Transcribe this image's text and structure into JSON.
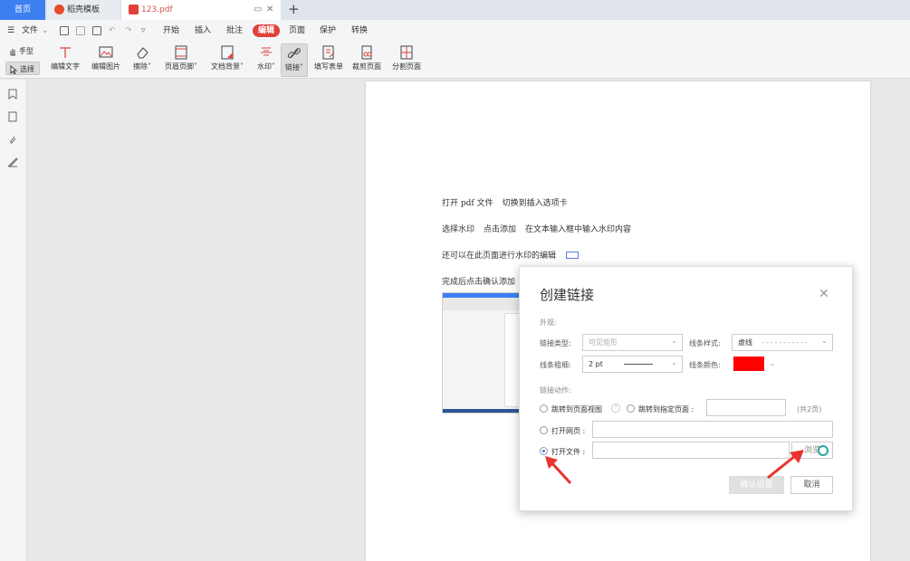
{
  "tabs": {
    "home": "首页",
    "templates": "稻壳模板",
    "document": "123.pdf"
  },
  "menu": {
    "file": "文件",
    "items": [
      "开始",
      "插入",
      "批注",
      "编辑",
      "页面",
      "保护",
      "转换"
    ],
    "active": "编辑"
  },
  "ribbon": {
    "hand": "手型",
    "select": "选择",
    "edit_text": "编辑文字",
    "edit_image": "编辑图片",
    "erase": "擦除",
    "header_footer": "页眉页脚",
    "doc_background": "文档背景",
    "watermark": "水印",
    "link": "链接",
    "fill_form": "填写表单",
    "crop_page": "裁剪页面",
    "split_page": "分割页面"
  },
  "document": {
    "line1": [
      "打开 pdf 文件",
      "切换到插入选项卡"
    ],
    "line2": [
      "选择水印",
      "点击添加",
      "在文本输入框中输入水印内容"
    ],
    "line3": "还可以在此页面进行水印的编辑",
    "line4": "完成后点击确认添加"
  },
  "dialog": {
    "title": "创建链接",
    "appearance_section": "外观:",
    "link_type_label": "链接类型:",
    "link_type_value": "可见矩形",
    "line_style_label": "线条样式:",
    "line_style_value": "虚线",
    "line_style_preview": "- - - - - - - - - - -",
    "line_width_label": "线条粗细:",
    "line_width_value": "2 pt",
    "line_color_label": "线条颜色:",
    "line_color": "#ff0000",
    "action_section": "链接动作:",
    "action_page_view": "跳转到页面视图",
    "action_specific_page": "跳转到指定页面 :",
    "total_pages": "(共2页)",
    "action_web": "打开网页 :",
    "action_file": "打开文件 :",
    "browse": "浏览",
    "confirm": "确认设置",
    "cancel": "取消"
  },
  "colors": {
    "accent": "#3d7ff0",
    "menu_active": "#e0413a",
    "arrow": "#e8342c"
  }
}
